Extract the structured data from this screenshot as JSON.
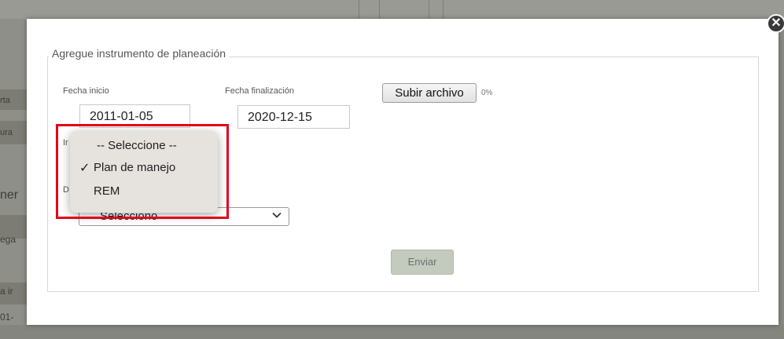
{
  "background": {
    "left_fragments": [
      "rta",
      "ura",
      "ner",
      "ega",
      "a ir",
      "01-"
    ]
  },
  "modal": {
    "close_glyph": "✕",
    "legend": "Agregue instrumento de planeación",
    "start_date": {
      "label": "Fecha inicio",
      "value": "2011-01-05"
    },
    "end_date": {
      "label": "Fecha finalización",
      "value": "2020-12-15"
    },
    "upload": {
      "button_label": "Subir archivo",
      "progress": "0%"
    },
    "instrument_label_fragment": "Ir",
    "document_label_fragment": "D",
    "select": {
      "value": "Selecciono"
    },
    "send_label": "Enviar"
  },
  "dropdown": {
    "options": [
      {
        "label": "-- Seleccione --",
        "checked": false
      },
      {
        "label": "Plan de manejo",
        "checked": true
      },
      {
        "label": "REM",
        "checked": false
      }
    ],
    "check_glyph": "✓"
  },
  "colors": {
    "highlight": "#e3001b",
    "send_button": "#c3cbbf"
  }
}
